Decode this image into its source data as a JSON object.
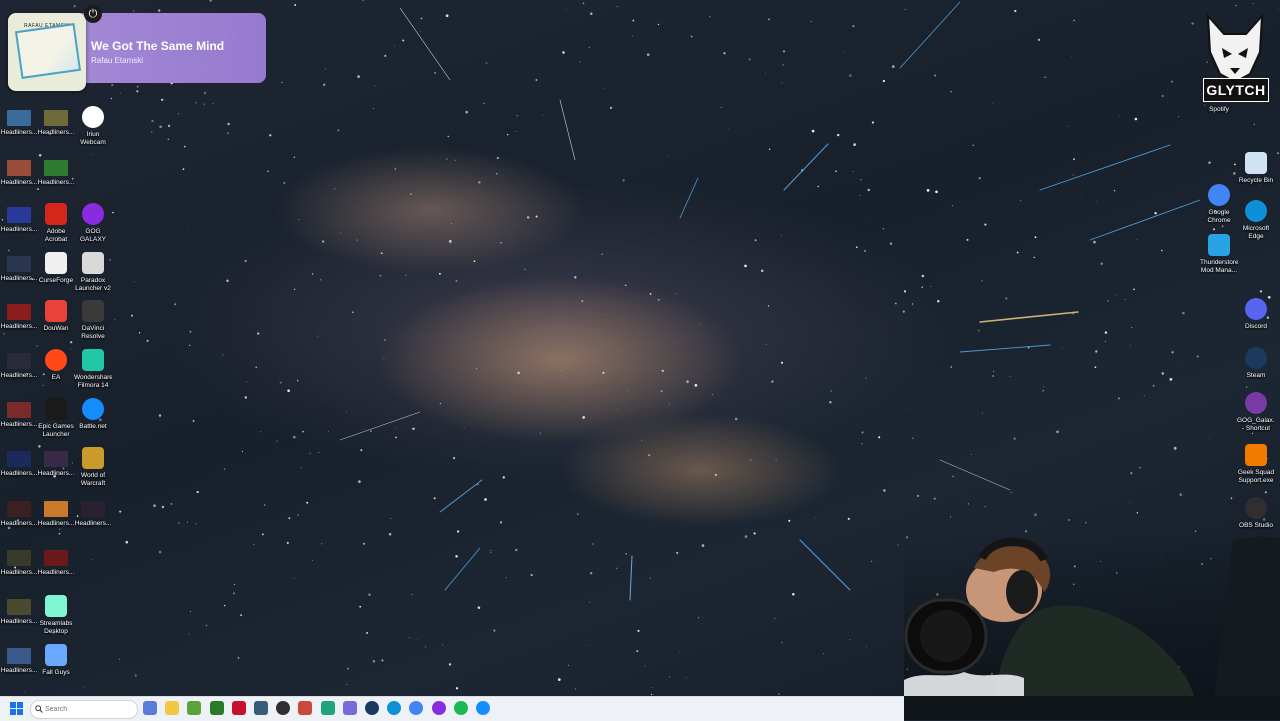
{
  "now_playing": {
    "title": "We Got The Same Mind",
    "artist": "Rafau Etamski",
    "album_art_text": "RAFAU ETAMSKI"
  },
  "brand_overlay": {
    "logo_text": "GLYTCH",
    "caption": "Spotify"
  },
  "desktop_icons_left": [
    {
      "label": "Headliners...",
      "icon": "thumbnail-icon",
      "color": "#3a6b9a"
    },
    {
      "label": "Headliners...",
      "icon": "thumbnail-icon",
      "color": "#6e6a3a"
    },
    {
      "label": "Iriun Webcam",
      "icon": "webcam-icon",
      "color": "#ffffff"
    },
    {
      "label": "Headliners...",
      "icon": "thumbnail-icon",
      "color": "#9a4c3a"
    },
    {
      "label": "Headliners...",
      "icon": "thumbnail-icon",
      "color": "#2e7a2e"
    },
    {
      "label": "Headliners...",
      "icon": "thumbnail-icon",
      "color": "#2a3a9a"
    },
    {
      "label": "Adobe Acrobat",
      "icon": "acrobat-icon",
      "color": "#d6261c"
    },
    {
      "label": "GOG GALAXY",
      "icon": "gog-icon",
      "color": "#8a2be2"
    },
    {
      "label": "Headliners...",
      "icon": "thumbnail-icon",
      "color": "#2a3550"
    },
    {
      "label": "CurseForge",
      "icon": "curseforge-icon",
      "color": "#f0f0f0"
    },
    {
      "label": "Paradox Launcher v2",
      "icon": "paradox-icon",
      "color": "#d9d9d9"
    },
    {
      "label": "Headliners...",
      "icon": "thumbnail-icon",
      "color": "#8a1e1e"
    },
    {
      "label": "DouWan",
      "icon": "douwan-icon",
      "color": "#e8423b"
    },
    {
      "label": "DaVinci Resolve",
      "icon": "davinci-icon",
      "color": "#3a3a3a"
    },
    {
      "label": "Headliners...",
      "icon": "thumbnail-icon",
      "color": "#2a2a3a"
    },
    {
      "label": "EA",
      "icon": "ea-icon",
      "color": "#ff4a17"
    },
    {
      "label": "Wondershare Filmora 14",
      "icon": "filmora-icon",
      "color": "#1fc7a6"
    },
    {
      "label": "Headliners...",
      "icon": "thumbnail-icon",
      "color": "#7a2a2a"
    },
    {
      "label": "Epic Games Launcher",
      "icon": "epic-icon",
      "color": "#1a1a1a"
    },
    {
      "label": "Battle.net",
      "icon": "battlenet-icon",
      "color": "#148eff"
    },
    {
      "label": "Headliners...",
      "icon": "thumbnail-icon",
      "color": "#1a2a5a"
    },
    {
      "label": "Headliners...",
      "icon": "thumbnail-icon",
      "color": "#3a2a4a"
    },
    {
      "label": "World of Warcraft",
      "icon": "wow-icon",
      "color": "#c89b2c"
    },
    {
      "label": "Headliners...",
      "icon": "thumbnail-icon",
      "color": "#3a2020"
    },
    {
      "label": "Headliners...",
      "icon": "thumbnail-icon",
      "color": "#c87a2a"
    },
    {
      "label": "Headliners...",
      "icon": "thumbnail-icon",
      "color": "#2a2030"
    },
    {
      "label": "Headliners...",
      "icon": "thumbnail-icon",
      "color": "#3a3a2a"
    },
    {
      "label": "Headliners...",
      "icon": "thumbnail-icon",
      "color": "#6a1a1a"
    },
    {
      "label": "Headliners...",
      "icon": "thumbnail-icon",
      "color": "#4a4a30"
    },
    {
      "label": "Streamlabs Desktop",
      "icon": "streamlabs-icon",
      "color": "#80f5d2"
    },
    {
      "label": "Headliners...",
      "icon": "thumbnail-icon",
      "color": "#3a5a8a"
    },
    {
      "label": "Fall Guys",
      "icon": "fallguys-icon",
      "color": "#6aa8ff"
    }
  ],
  "desktop_icons_right": [
    {
      "label": "Recycle Bin",
      "icon": "recycle-bin-icon",
      "color": "#cfe3f5"
    },
    {
      "label": "Google Chrome",
      "icon": "chrome-icon",
      "color": "#4285f4"
    },
    {
      "label": "Microsoft Edge",
      "icon": "edge-icon",
      "color": "#0f8fd8"
    },
    {
      "label": "Thunderstore Mod Mana...",
      "icon": "thunderstore-icon",
      "color": "#29a3e6"
    },
    {
      "label": "Discord",
      "icon": "discord-icon",
      "color": "#5865f2"
    },
    {
      "label": "Steam",
      "icon": "steam-icon",
      "color": "#1b3a5c"
    },
    {
      "label": "GOG_Galax... - Shortcut",
      "icon": "gog-icon",
      "color": "#7a3aa5"
    },
    {
      "label": "Geek Squad Support.exe",
      "icon": "geek-squad-icon",
      "color": "#f27a00"
    },
    {
      "label": "OBS Studio",
      "icon": "obs-icon",
      "color": "#302e31"
    }
  ],
  "taskbar": {
    "search_placeholder": "Search",
    "apps": [
      {
        "name": "copilot-icon",
        "color": "#5a7bd8"
      },
      {
        "name": "file-explorer-icon",
        "color": "#f2c744"
      },
      {
        "name": "minecraft-icon",
        "color": "#5aa33a"
      },
      {
        "name": "xbox-icon",
        "color": "#2a7a2a"
      },
      {
        "name": "acrobat-icon",
        "color": "#c8102e"
      },
      {
        "name": "app-icon",
        "color": "#3a5a7a"
      },
      {
        "name": "obs-icon",
        "color": "#302e31"
      },
      {
        "name": "davinci-icon",
        "color": "#c84a3a"
      },
      {
        "name": "streamlabs-icon",
        "color": "#1ea37a"
      },
      {
        "name": "app-icon",
        "color": "#7a6ad8"
      },
      {
        "name": "steam-icon",
        "color": "#1b3a5c"
      },
      {
        "name": "edge-icon",
        "color": "#0f8fd8"
      },
      {
        "name": "chrome-icon",
        "color": "#4285f4"
      },
      {
        "name": "gog-icon",
        "color": "#8a2be2"
      },
      {
        "name": "spotify-icon",
        "color": "#1db954"
      },
      {
        "name": "battlenet-icon",
        "color": "#148eff"
      }
    ]
  }
}
